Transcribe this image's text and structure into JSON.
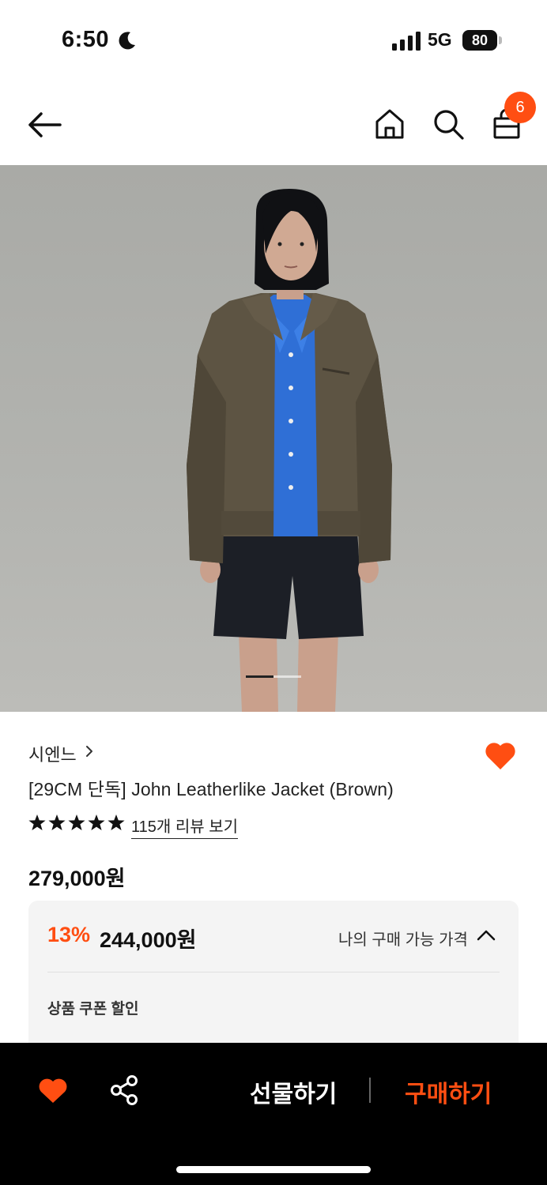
{
  "status_bar": {
    "time": "6:50",
    "network": "5G",
    "battery": "80",
    "icons": [
      "moon-icon",
      "signal-icon",
      "battery-icon"
    ]
  },
  "nav": {
    "icons": [
      "arrow-left-icon",
      "home-icon",
      "search-icon",
      "bag-icon"
    ],
    "cart_count": "6"
  },
  "gallery": {
    "current_index": 1,
    "total": 2
  },
  "product": {
    "brand": "시엔느",
    "title": "[29CM 단독] John Leatherlike Jacket (Brown)",
    "rating_stars": 5,
    "review_link": "115개 리뷰 보기",
    "original_price": "279,000원",
    "wishlisted": true
  },
  "price_panel": {
    "discount": "13%",
    "sale_price": "244,000원",
    "my_price_label": "나의 구매 가능 가격",
    "coupon_label": "상품 쿠폰 할인"
  },
  "bottom_bar": {
    "gift_label": "선물하기",
    "buy_label": "구매하기",
    "icons": [
      "heart-icon",
      "share-icon"
    ]
  },
  "colors": {
    "accent": "#ff4e12",
    "bottom_bar": "#000000",
    "panel_bg": "#f4f4f4"
  }
}
